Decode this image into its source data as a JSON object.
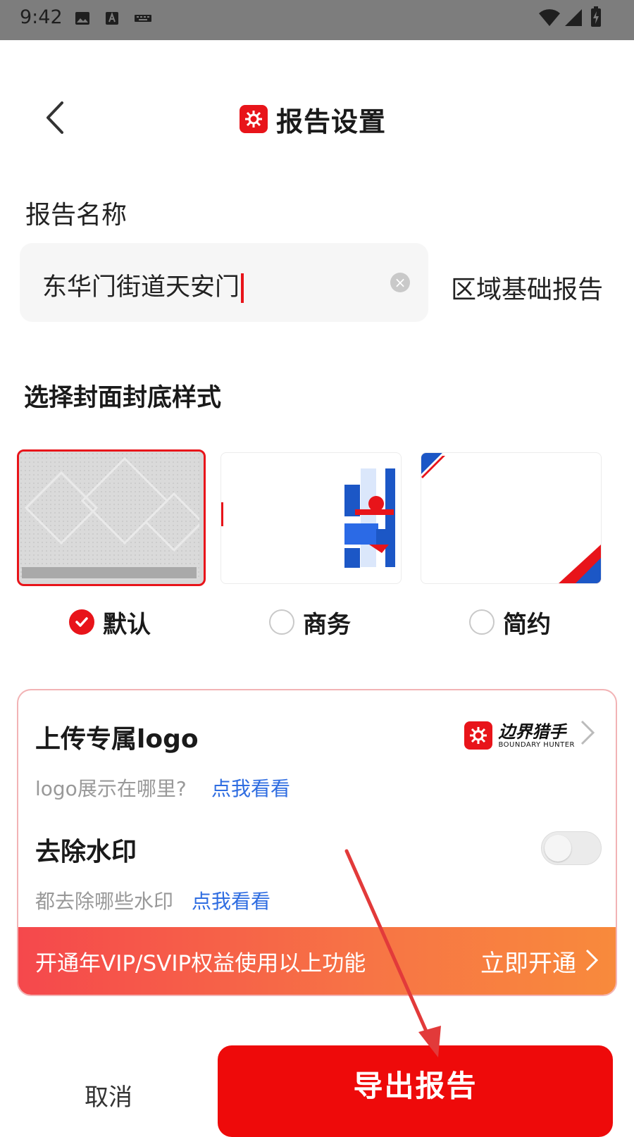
{
  "status_bar": {
    "time": "9:42"
  },
  "header": {
    "title": "报告设置"
  },
  "report_name": {
    "label": "报告名称",
    "value": "东华门街道天安门",
    "suffix": "区域基础报告"
  },
  "cover_style": {
    "title": "选择封面封底样式",
    "options": [
      {
        "label": "默认",
        "selected": true
      },
      {
        "label": "商务",
        "selected": false
      },
      {
        "label": "简约",
        "selected": false
      }
    ]
  },
  "vip_card": {
    "logo_title": "上传专属logo",
    "logo_hint": "logo展示在哪里?",
    "logo_link": "点我看看",
    "brand_cn": "边界猎手",
    "brand_en": "BOUNDARY HUNTER",
    "watermark_title": "去除水印",
    "watermark_hint": "都去除哪些水印",
    "watermark_link": "点我看看",
    "watermark_enabled": false,
    "vip_text": "开通年VIP/SVIP权益使用以上功能",
    "vip_cta": "立即开通"
  },
  "footer": {
    "cancel": "取消",
    "export": "导出报告"
  },
  "colors": {
    "accent": "#e8141a",
    "link": "#2f6de1",
    "vip_gradient_start": "#f5484c",
    "vip_gradient_end": "#f88a3c"
  }
}
